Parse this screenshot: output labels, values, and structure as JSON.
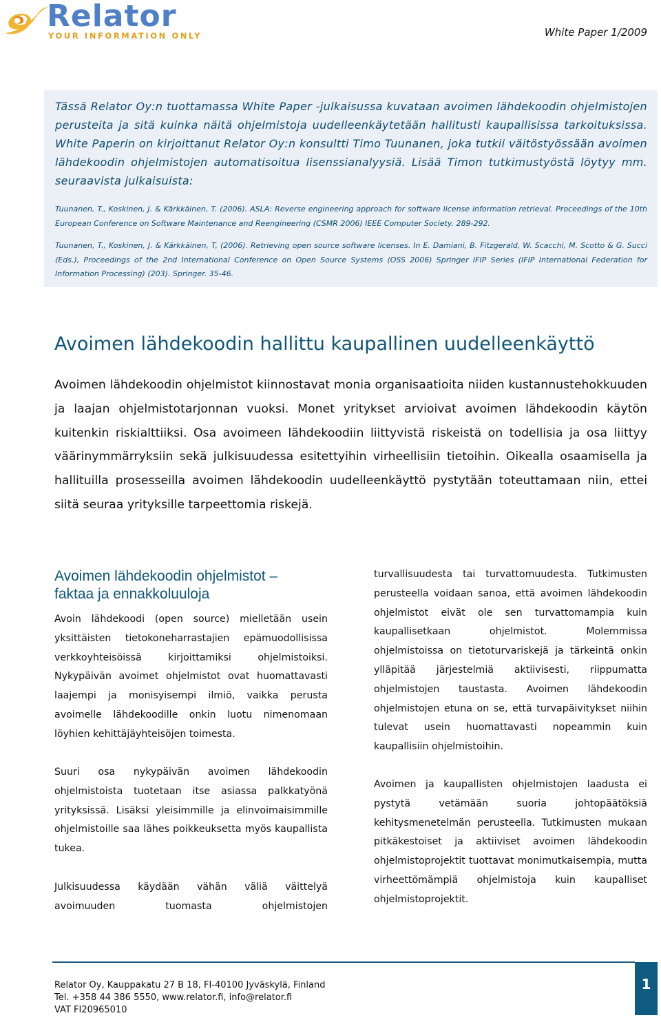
{
  "header": {
    "logo": {
      "name": "Relator",
      "tagline": "YOUR INFORMATION ONLY",
      "icon": "swirl-logo-icon",
      "colors": {
        "name": "#4f7fc7",
        "tagline": "#e0a01c"
      }
    },
    "doc_label": "White Paper 1/2009"
  },
  "intro": {
    "text": "Tässä Relator Oy:n tuottamassa White Paper -julkaisussa kuvataan avoimen lähdekoodin ohjelmistojen perusteita ja sitä kuinka näitä ohjelmistoja uudelleenkäytetään hallitusti kaupallisissa tarkoituksissa. White Paperin on kirjoittanut Relator Oy:n konsultti Timo Tuunanen, joka tutkii väitöstyössään avoimen lähdekoodin ohjelmistojen automatisoitua lisenssianalyysiä. Lisää Timon tutkimustyöstä löytyy mm. seuraavista julkaisuista:",
    "references": [
      "Tuunanen, T., Koskinen, J. & Kärkkäinen, T. (2006). ASLA: Reverse engineering approach for software license information retrieval. Proceedings of the 10th European Conference on Software Maintenance and Reengineering (CSMR 2006) IEEE Computer Society. 289-292.",
      "Tuunanen, T., Koskinen, J. & Kärkkäinen, T, (2006). Retrieving open source software licenses. In E. Damiani, B. Fitzgerald, W. Scacchi, M. Scotto & G. Succi (Eds.), Proceedings of the 2nd International Conference on Open Source Systems (OSS 2006) Springer IFIP Series (IFIP International Federation for Information Processing) (203). Springer. 35-46."
    ],
    "background": "#ebf0f7",
    "text_color": "#0f4b6e"
  },
  "main": {
    "title": "Avoimen lähdekoodin hallittu kaupallinen uudelleenkäyttö",
    "lead": "Avoimen lähdekoodin ohjelmistot kiinnostavat monia organisaatioita niiden kustannustehokkuuden ja laajan ohjelmistotarjonnan vuoksi. Monet yritykset arvioivat avoimen lähdekoodin käytön kuitenkin riskialttiiksi. Osa avoimeen lähdekoodiin liittyvistä riskeistä on todellisia ja osa liittyy väärinymmärryksiin sekä julkisuudessa esitettyihin virheellisiin tietoihin. Oikealla osaamisella ja hallituilla prosesseilla avoimen lähdekoodin uudelleenkäyttö pystytään toteuttamaan niin, ettei siitä seuraa yrityksille tarpeettomia riskejä.",
    "section": {
      "title_line1": "Avoimen lähdekoodin ohjelmistot –",
      "title_line2": "faktaa ja ennakkoluuloja",
      "left_column": [
        "Avoin lähdekoodi (open source) mielletään usein yksittäisten tietokoneharrastajien epämuodollisissa verkkoyhteisöissä kirjoittamiksi ohjelmistoiksi. Nykypäivän avoimet ohjelmistot ovat huomattavasti laajempi ja monisyisempi ilmiö, vaikka perusta avoimelle lähdekoodille onkin luotu nimenomaan löyhien kehittäjäyhteisöjen toimesta.",
        "Suuri osa nykypäivän avoimen lähdekoodin ohjelmistoista tuotetaan itse asiassa palkkatyönä yrityksissä. Lisäksi yleisimmille ja elinvoimaisimmille ohjelmistoille saa lähes poikkeuksetta myös kaupallista tukea.",
        "Julkisuudessa käydään vähän väliä väittelyä avoimuuden tuomasta ohjelmistojen"
      ],
      "right_column": [
        "turvallisuudesta tai turvattomuudesta. Tutkimusten perusteella voidaan sanoa, että avoimen lähdekoodin ohjelmistot eivät ole sen turvattomampia kuin kaupallisetkaan ohjelmistot. Molemmissa ohjelmistoissa on tietoturvariskejä ja tärkeintä onkin ylläpitää järjestelmiä aktiivisesti, riippumatta ohjelmistojen taustasta. Avoimen lähdekoodin ohjelmistojen etuna on se, että turvapäivitykset niihin tulevat usein huomattavasti nopeammin kuin kaupallisiin ohjelmistoihin.",
        "Avoimen ja kaupallisten ohjelmistojen laadusta ei pystytä vetämään suoria johtopäätöksiä kehitysmenetelmän perusteella. Tutkimusten mukaan pitkäkestoiset ja aktiiviset avoimen lähdekoodin ohjelmistoprojektit tuottavat monimutkaisempia, mutta virheettömämpiä ohjelmistoja kuin kaupalliset ohjelmistoprojektit."
      ]
    },
    "heading_color": "#0f5578"
  },
  "footer": {
    "address": "Relator Oy, Kauppakatu 27 B 18, FI-40100 Jyväskylä, Finland",
    "contact": "Tel. +358 44 386 5550, www.relator.fi, info@relator.fi",
    "vat": "VAT FI20965010",
    "page_number": "1",
    "accent": "#0f5a80"
  }
}
